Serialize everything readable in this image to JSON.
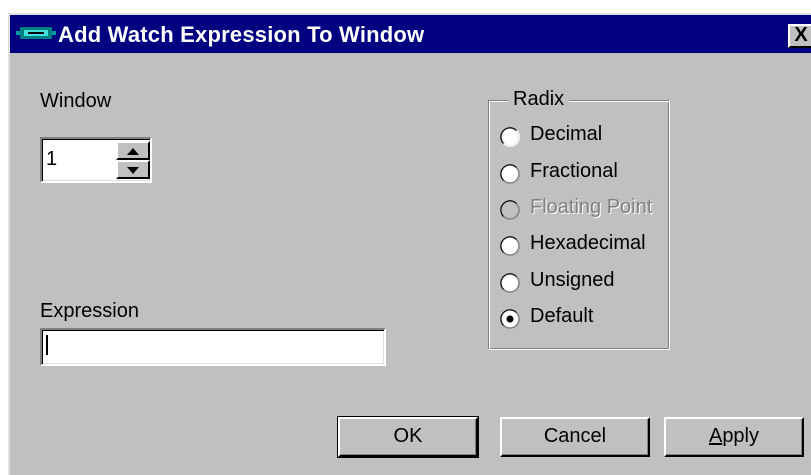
{
  "dialog": {
    "title": "Add Watch Expression To Window",
    "close_glyph": "X",
    "icon": "app-icon"
  },
  "window_field": {
    "label": "Window",
    "value": "1"
  },
  "expression_field": {
    "label": "Expression",
    "value": ""
  },
  "radix": {
    "label": "Radix",
    "selected": "Default",
    "options": [
      {
        "label": "Decimal",
        "enabled": true,
        "checked": false
      },
      {
        "label": "Fractional",
        "enabled": true,
        "checked": false
      },
      {
        "label": "Floating Point",
        "enabled": false,
        "checked": false
      },
      {
        "label": "Hexadecimal",
        "enabled": true,
        "checked": false
      },
      {
        "label": "Unsigned",
        "enabled": true,
        "checked": false
      },
      {
        "label": "Default",
        "enabled": true,
        "checked": true
      }
    ]
  },
  "buttons": {
    "ok": "OK",
    "cancel": "Cancel",
    "apply": "Apply"
  },
  "colors": {
    "titlebar": "#000080",
    "face": "#c0c0c0",
    "disabled_text": "#808080"
  }
}
